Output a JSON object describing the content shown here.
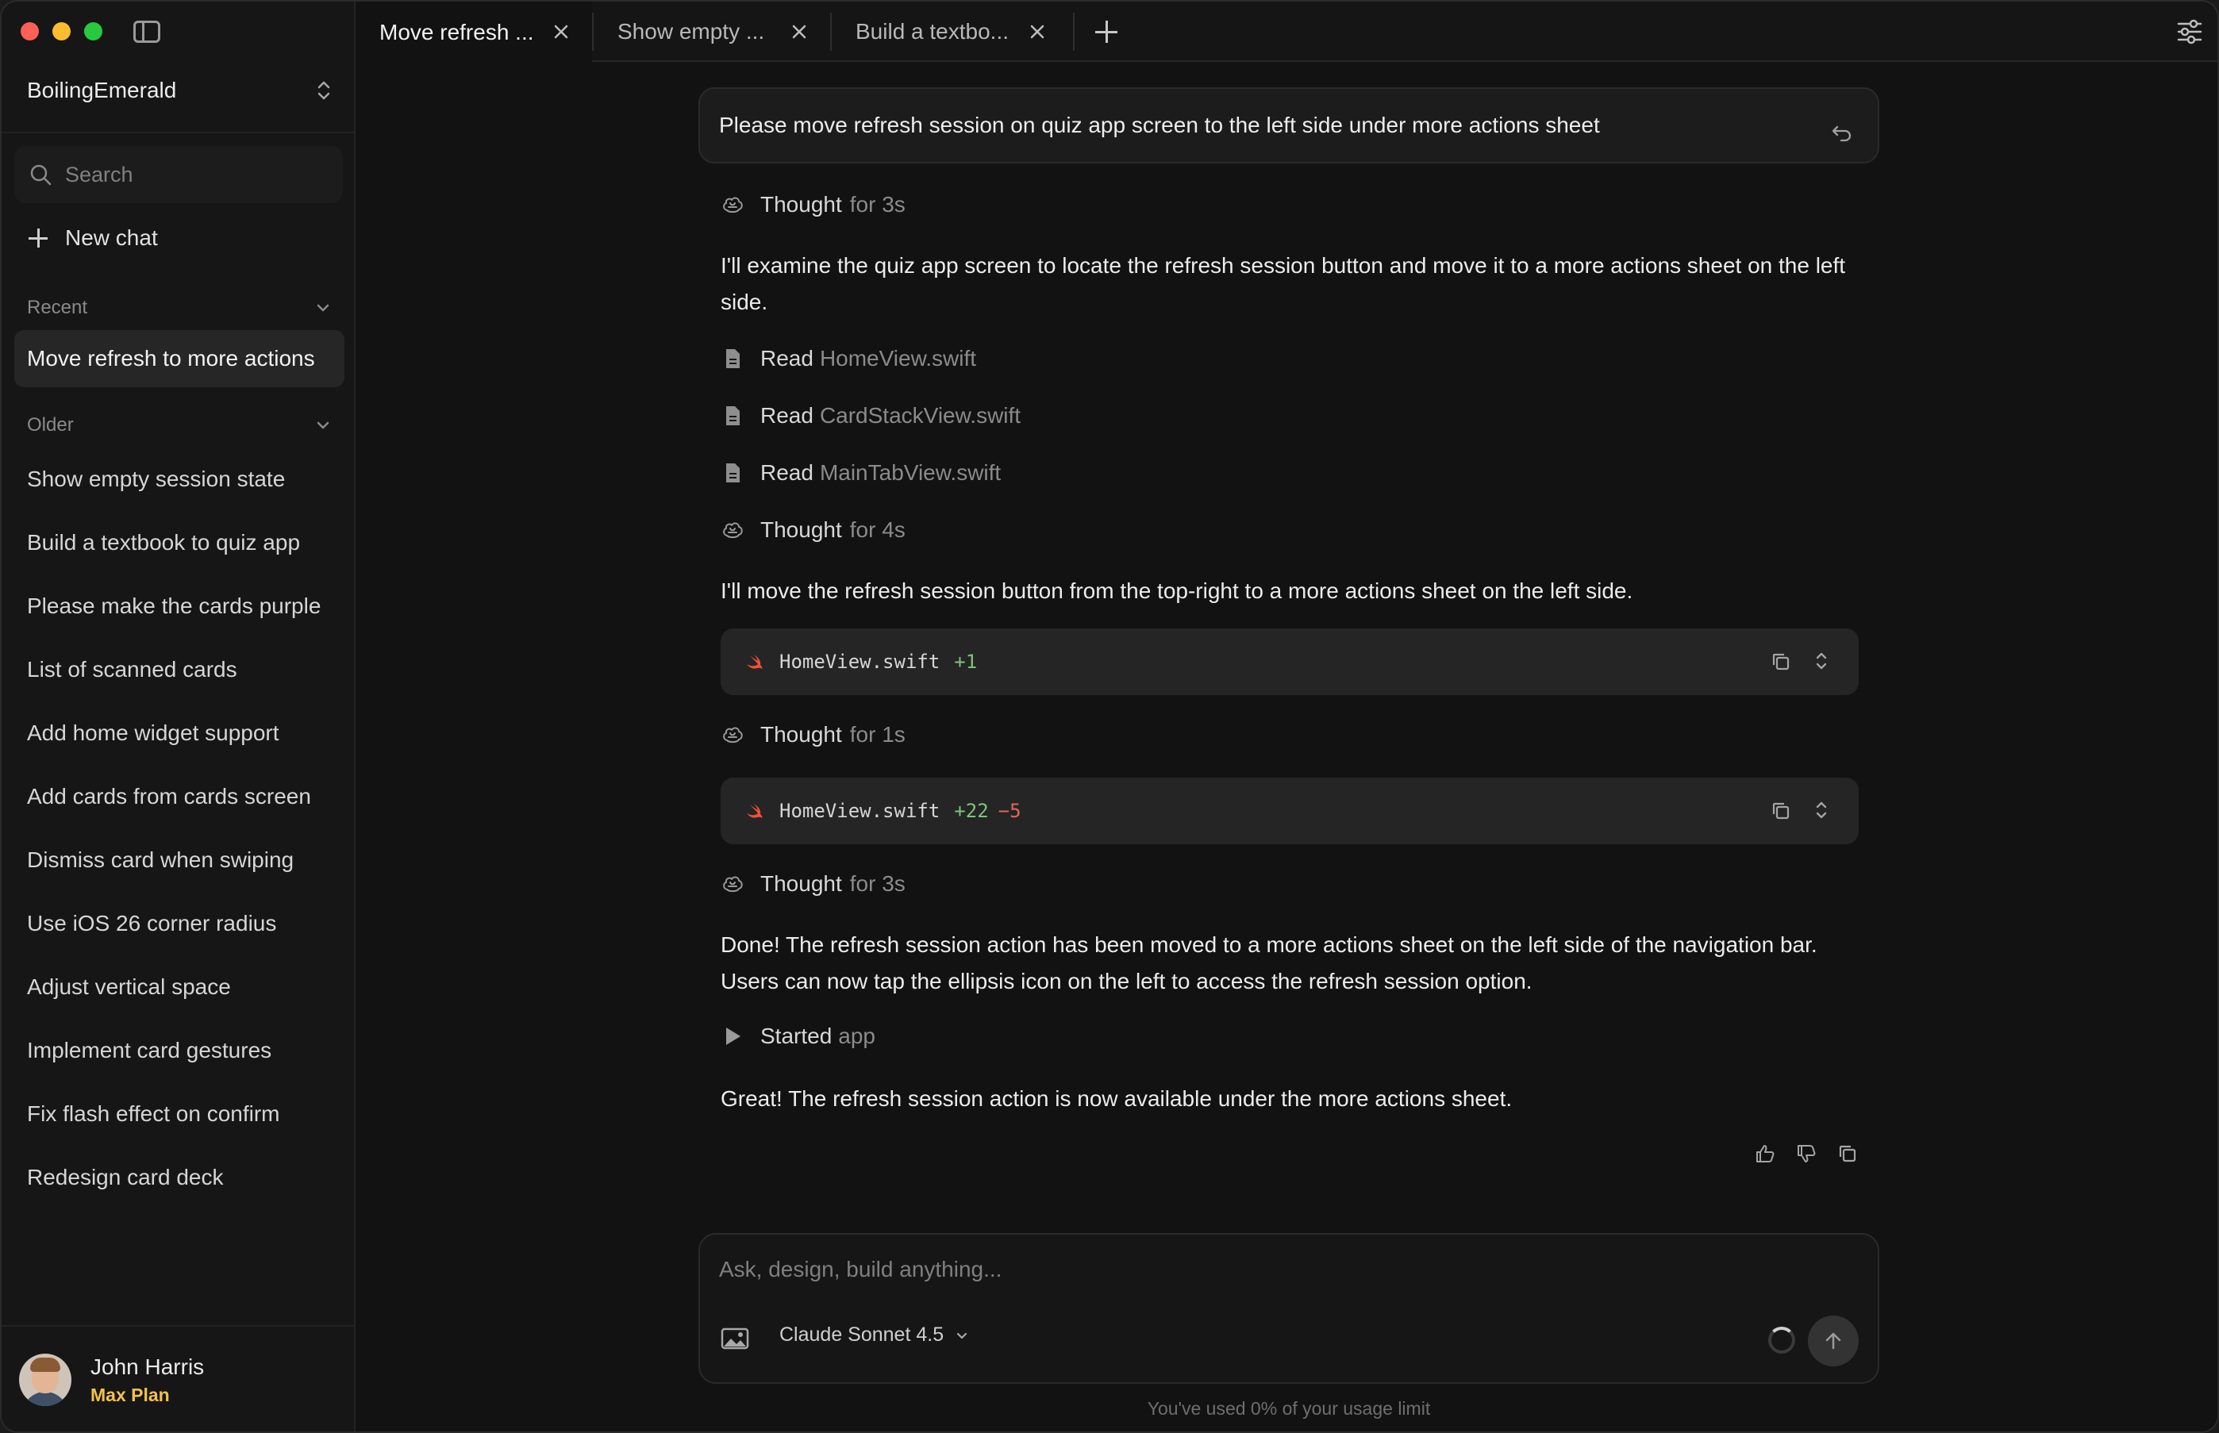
{
  "sidebar": {
    "workspace": "BoilingEmerald",
    "search_placeholder": "Search",
    "new_chat": "New chat",
    "recent_label": "Recent",
    "recent_items": [
      "Move refresh to more actions"
    ],
    "older_label": "Older",
    "older_items": [
      "Show empty session state",
      "Build a textbook to quiz app",
      "Please make the cards purple",
      "List of scanned cards",
      "Add home widget support",
      "Add cards from cards screen",
      "Dismiss card when swiping",
      "Use iOS 26 corner radius",
      "Adjust vertical space",
      "Implement card gestures",
      "Fix flash effect on confirm",
      "Redesign card deck"
    ],
    "user": {
      "name": "John Harris",
      "plan": "Max Plan"
    }
  },
  "tabs": [
    {
      "label": "Move refresh ...",
      "active": true
    },
    {
      "label": "Show empty ...",
      "active": false
    },
    {
      "label": "Build a textbo...",
      "active": false
    }
  ],
  "chat": {
    "user_message": "Please move refresh session on quiz app screen to the left side under more actions sheet",
    "thought1": {
      "label": "Thought",
      "duration": "for 3s"
    },
    "para1": "I'll examine the quiz app screen to locate the refresh session button and move it to a more actions sheet on the left side.",
    "reads": [
      {
        "verb": "Read",
        "file": "HomeView.swift"
      },
      {
        "verb": "Read",
        "file": "CardStackView.swift"
      },
      {
        "verb": "Read",
        "file": "MainTabView.swift"
      }
    ],
    "thought2": {
      "label": "Thought",
      "duration": "for 4s"
    },
    "para2": "I'll move the refresh session button from the top-right to a more actions sheet on the left side.",
    "code1": {
      "file": "HomeView.swift",
      "added": "+1"
    },
    "thought3": {
      "label": "Thought",
      "duration": "for 1s"
    },
    "code2": {
      "file": "HomeView.swift",
      "added": "+22",
      "removed": "−5"
    },
    "thought4": {
      "label": "Thought",
      "duration": "for 3s"
    },
    "para3": "Done! The refresh session action has been moved to a more actions sheet on the left side of the navigation bar. Users can now tap the ellipsis icon on the left to access the refresh session option.",
    "started": {
      "label": "Started",
      "target": "app"
    },
    "para4": "Great! The refresh session action is now available under the more actions sheet."
  },
  "composer": {
    "placeholder": "Ask, design, build anything...",
    "model": "Claude Sonnet 4.5",
    "usage": "You've used 0% of your usage limit"
  },
  "colors": {
    "plan_badge": "#f3c14a",
    "diff_added": "#7cc47a",
    "diff_removed": "#e3655f",
    "swift": "#f05138"
  }
}
